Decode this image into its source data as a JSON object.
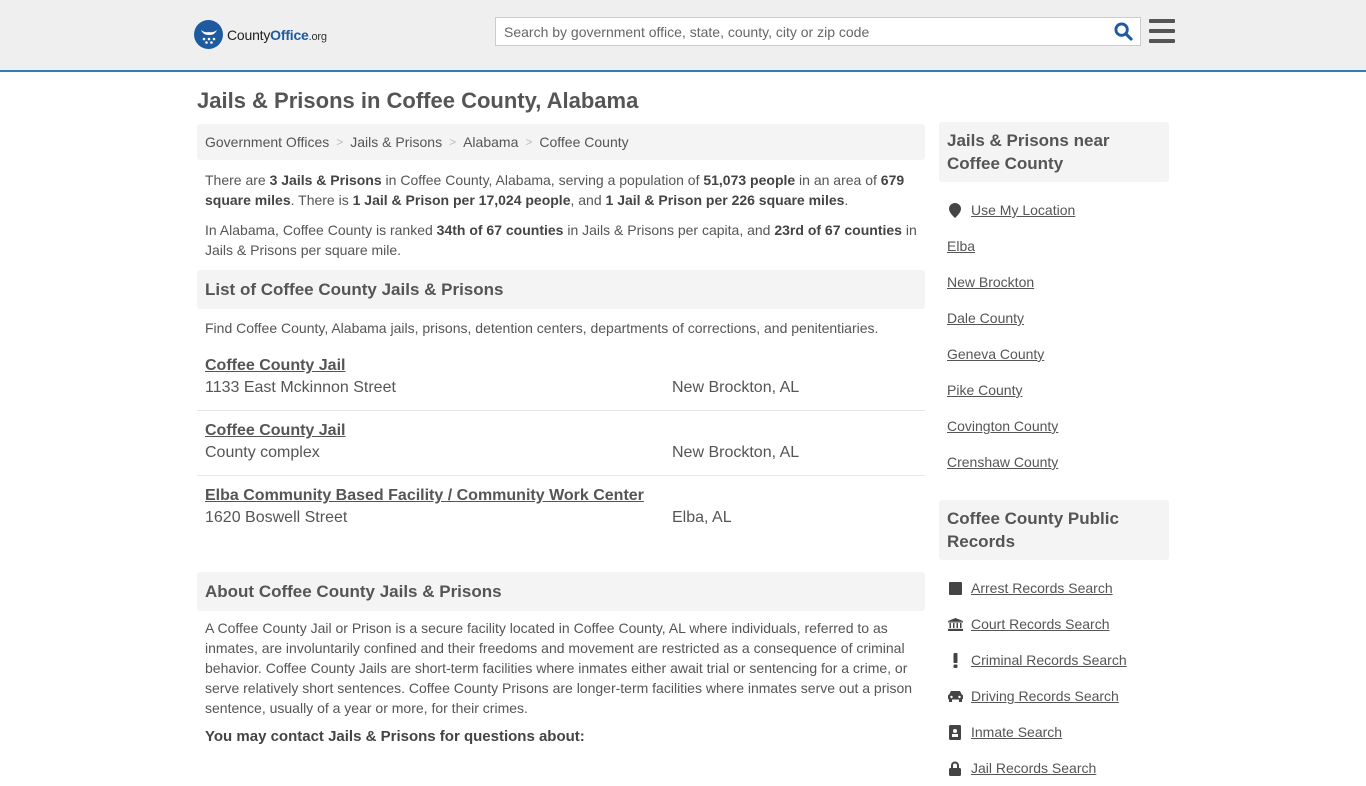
{
  "header": {
    "logo": {
      "county": "County",
      "office": "Office",
      "org": ".org"
    },
    "search_placeholder": "Search by government office, state, county, city or zip code"
  },
  "page_title": "Jails & Prisons in Coffee County, Alabama",
  "breadcrumb": [
    "Government Offices",
    "Jails & Prisons",
    "Alabama",
    "Coffee County"
  ],
  "intro": {
    "p1": [
      {
        "t": "There are ",
        "b": false
      },
      {
        "t": "3 Jails & Prisons",
        "b": true
      },
      {
        "t": " in Coffee County, Alabama, serving a population of ",
        "b": false
      },
      {
        "t": "51,073 people",
        "b": true
      },
      {
        "t": " in an area of ",
        "b": false
      },
      {
        "t": "679 square miles",
        "b": true
      },
      {
        "t": ". There is ",
        "b": false
      },
      {
        "t": "1 Jail & Prison per 17,024 people",
        "b": true
      },
      {
        "t": ", and ",
        "b": false
      },
      {
        "t": "1 Jail & Prison per 226 square miles",
        "b": true
      },
      {
        "t": ".",
        "b": false
      }
    ],
    "p2": [
      {
        "t": "In Alabama, Coffee County is ranked ",
        "b": false
      },
      {
        "t": "34th of 67 counties",
        "b": true
      },
      {
        "t": " in Jails & Prisons per capita, and ",
        "b": false
      },
      {
        "t": "23rd of 67 counties",
        "b": true
      },
      {
        "t": " in Jails & Prisons per square mile.",
        "b": false
      }
    ]
  },
  "list_section": {
    "title": "List of Coffee County Jails & Prisons",
    "description": "Find Coffee County, Alabama jails, prisons, detention centers, departments of corrections, and penitentiaries.",
    "listings": [
      {
        "name": "Coffee County Jail",
        "address": "1133 East Mckinnon Street",
        "city": "New Brockton, AL"
      },
      {
        "name": "Coffee County Jail",
        "address": "County complex",
        "city": "New Brockton, AL"
      },
      {
        "name": "Elba Community Based Facility / Community Work Center",
        "address": "1620 Boswell Street",
        "city": "Elba, AL"
      }
    ]
  },
  "about_section": {
    "title": "About Coffee County Jails & Prisons",
    "body": "A Coffee County Jail or Prison is a secure facility located in Coffee County, AL where individuals, referred to as inmates, are involuntarily confined and their freedoms and movement are restricted as a consequence of criminal behavior. Coffee County Jails are short-term facilities where inmates either await trial or sentencing for a crime, or serve relatively short sentences. Coffee County Prisons are longer-term facilities where inmates serve out a prison sentence, usually of a year or more, for their crimes.",
    "contact_heading": "You may contact Jails & Prisons for questions about:"
  },
  "sidebar": {
    "nearby": {
      "title": "Jails & Prisons near Coffee County",
      "use_location": "Use My Location",
      "links": [
        "Elba",
        "New Brockton",
        "Dale County",
        "Geneva County",
        "Pike County",
        "Covington County",
        "Crenshaw County"
      ]
    },
    "records": {
      "title": "Coffee County Public Records",
      "links": [
        {
          "label": "Arrest Records Search",
          "icon": "square-icon"
        },
        {
          "label": "Court Records Search",
          "icon": "courthouse-icon"
        },
        {
          "label": "Criminal Records Search",
          "icon": "exclamation-icon"
        },
        {
          "label": "Driving Records Search",
          "icon": "car-icon"
        },
        {
          "label": "Inmate Search",
          "icon": "id-badge-icon"
        },
        {
          "label": "Jail Records Search",
          "icon": "lock-icon"
        }
      ]
    }
  },
  "colors": {
    "brand": "#1e5aa0",
    "header_border": "#337ab7",
    "text": "#555555",
    "panel": "#f4f4f4"
  }
}
